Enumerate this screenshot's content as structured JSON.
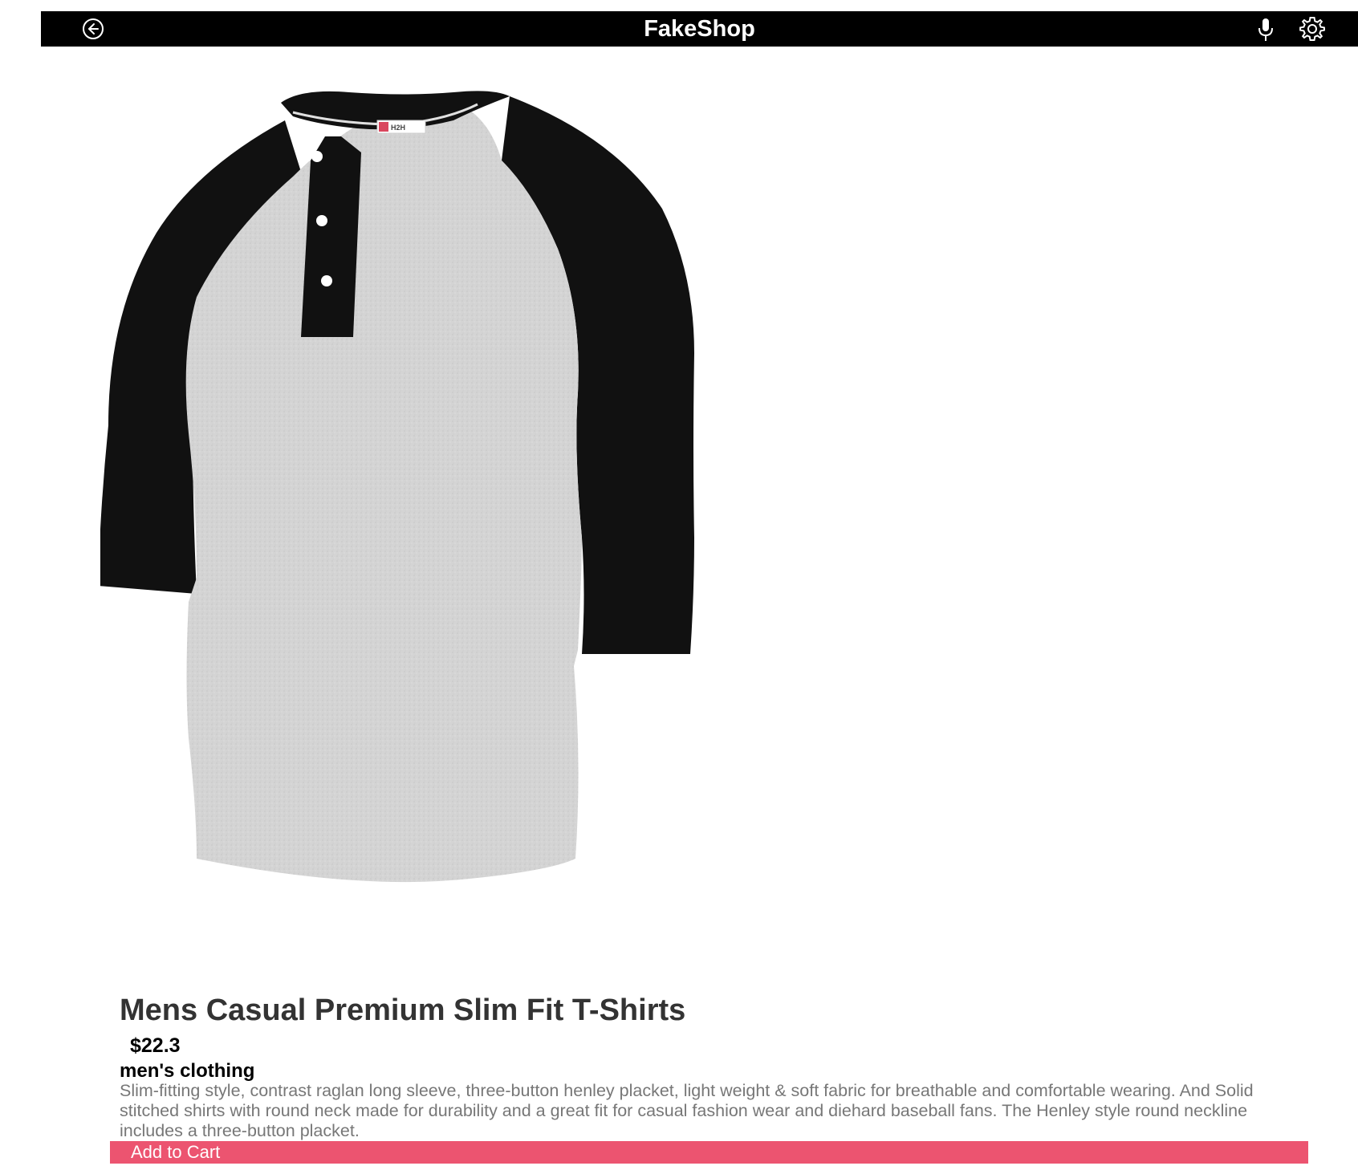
{
  "header": {
    "title": "FakeShop",
    "back_icon": "arrow-left-circle-icon",
    "mic_icon": "microphone-icon",
    "settings_icon": "gear-icon"
  },
  "product": {
    "title": "Mens Casual Premium Slim Fit T-Shirts",
    "price": "$22.3",
    "category": "men's clothing",
    "description": "Slim-fitting style, contrast raglan long sleeve, three-button henley placket, light weight & soft fabric for breathable and comfortable wearing. And Solid stitched shirts with round neck made for durability and a great fit for casual fashion wear and diehard baseball fans. The Henley style round neckline includes a three-button placket.",
    "image_label": "H2H"
  },
  "actions": {
    "add_to_cart_label": "Add to Cart"
  },
  "colors": {
    "header_bg": "#000000",
    "cta_bg": "#ec5470",
    "title_text": "#333333",
    "description_text": "#777777"
  }
}
